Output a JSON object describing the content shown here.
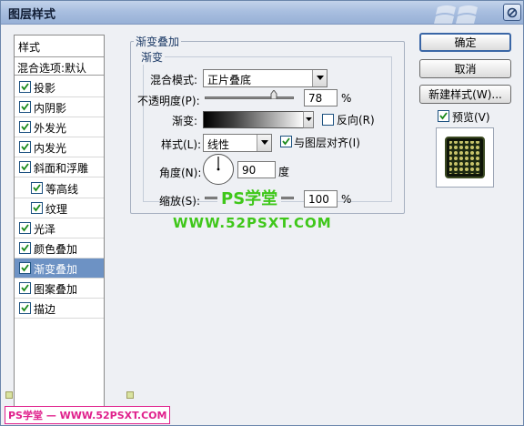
{
  "window": {
    "title": "图层样式",
    "close_icon": "close-x-icon"
  },
  "sidebar": {
    "header": "样式",
    "blend_options": "混合选项:默认",
    "items": [
      {
        "label": "投影",
        "checked": true,
        "selected": false,
        "indent": false
      },
      {
        "label": "内阴影",
        "checked": true,
        "selected": false,
        "indent": false
      },
      {
        "label": "外发光",
        "checked": true,
        "selected": false,
        "indent": false
      },
      {
        "label": "内发光",
        "checked": true,
        "selected": false,
        "indent": false
      },
      {
        "label": "斜面和浮雕",
        "checked": true,
        "selected": false,
        "indent": false
      },
      {
        "label": "等高线",
        "checked": true,
        "selected": false,
        "indent": true
      },
      {
        "label": "纹理",
        "checked": true,
        "selected": false,
        "indent": true
      },
      {
        "label": "光泽",
        "checked": true,
        "selected": false,
        "indent": false
      },
      {
        "label": "颜色叠加",
        "checked": true,
        "selected": false,
        "indent": false
      },
      {
        "label": "渐变叠加",
        "checked": true,
        "selected": true,
        "indent": false
      },
      {
        "label": "图案叠加",
        "checked": true,
        "selected": false,
        "indent": false
      },
      {
        "label": "描边",
        "checked": true,
        "selected": false,
        "indent": false
      }
    ]
  },
  "panel": {
    "group_title": "渐变叠加",
    "sub_title": "渐变",
    "blend_mode_label": "混合模式:",
    "blend_mode_value": "正片叠底",
    "opacity_label": "不透明度(P):",
    "opacity_value": "78",
    "opacity_unit": "%",
    "opacity_fraction": 0.78,
    "gradient_label": "渐变:",
    "reverse_label": "反向(R)",
    "reverse_checked": false,
    "style_label": "样式(L):",
    "style_value": "线性",
    "align_label": "与图层对齐(I)",
    "align_checked": true,
    "angle_label": "角度(N):",
    "angle_value": "90",
    "angle_unit": "度",
    "scale_label": "缩放(S):",
    "scale_value": "100",
    "scale_unit": "%"
  },
  "buttons": {
    "ok": "确定",
    "cancel": "取消",
    "new_style": "新建样式(W)...",
    "preview_label": "预览(V)",
    "preview_checked": true
  },
  "watermarks": {
    "center_title": "PS学堂",
    "center_url": "WWW.52PSXT.COM",
    "bottom_left": "PS学堂 — WWW.52PSXT.COM"
  },
  "colors": {
    "accent": "#6d92c4",
    "watermark_green": "#3fc71a",
    "watermark_pink": "#e0208c"
  }
}
